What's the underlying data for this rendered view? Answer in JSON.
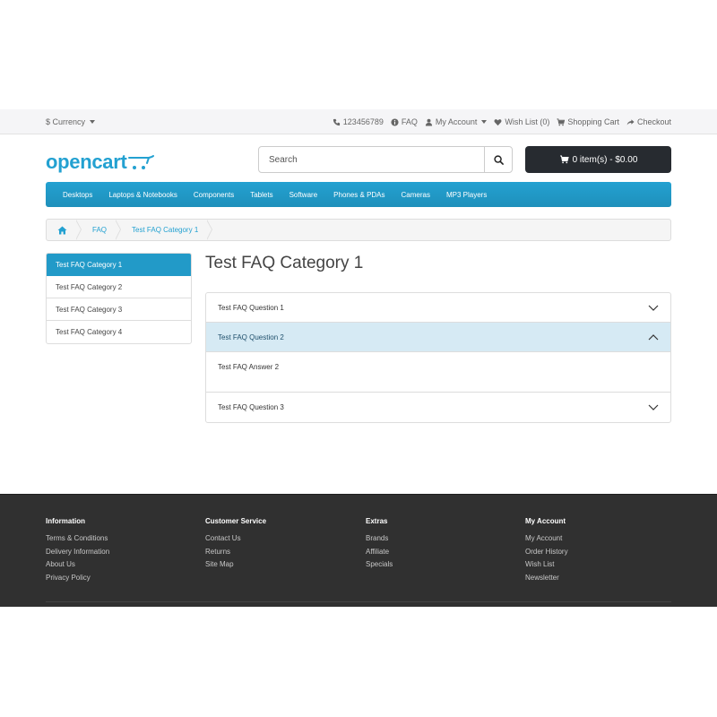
{
  "topbar": {
    "currency_label": "$ Currency",
    "phone": "123456789",
    "faq": "FAQ",
    "my_account": "My Account",
    "wish_list": "Wish List (0)",
    "shopping_cart": "Shopping Cart",
    "checkout": "Checkout"
  },
  "header": {
    "logo_text": "opencart",
    "search_placeholder": "Search",
    "cart_label": "0 item(s) - $0.00"
  },
  "menu": {
    "items": [
      "Desktops",
      "Laptops & Notebooks",
      "Components",
      "Tablets",
      "Software",
      "Phones & PDAs",
      "Cameras",
      "MP3 Players"
    ]
  },
  "breadcrumb": {
    "items": [
      "FAQ",
      "Test FAQ Category 1"
    ]
  },
  "sidebar": {
    "items": [
      "Test FAQ Category 1",
      "Test FAQ Category 2",
      "Test FAQ Category 3",
      "Test FAQ Category 4"
    ]
  },
  "main": {
    "title": "Test FAQ Category 1",
    "questions": [
      {
        "question": "Test FAQ Question 1",
        "expanded": false
      },
      {
        "question": "Test FAQ Question 2",
        "expanded": true,
        "answer": "Test FAQ Answer 2"
      },
      {
        "question": "Test FAQ Question 3",
        "expanded": false
      }
    ]
  },
  "footer": {
    "columns": [
      {
        "heading": "Information",
        "links": [
          "Terms & Conditions",
          "Delivery Information",
          "About Us",
          "Privacy Policy"
        ]
      },
      {
        "heading": "Customer Service",
        "links": [
          "Contact Us",
          "Returns",
          "Site Map"
        ]
      },
      {
        "heading": "Extras",
        "links": [
          "Brands",
          "Affiliate",
          "Specials"
        ]
      },
      {
        "heading": "My Account",
        "links": [
          "My Account",
          "Order History",
          "Wish List",
          "Newsletter"
        ]
      }
    ]
  },
  "colors": {
    "brand_blue": "#229ac8",
    "cart_dark": "#272b30",
    "footer_bg": "#303030",
    "open_question_bg": "#d6eaf4"
  },
  "icons": [
    "phone-icon",
    "info-icon",
    "user-icon",
    "heart-icon",
    "cart-icon",
    "share-icon",
    "search-icon",
    "home-icon",
    "chevron-down-icon",
    "chevron-up-icon"
  ]
}
